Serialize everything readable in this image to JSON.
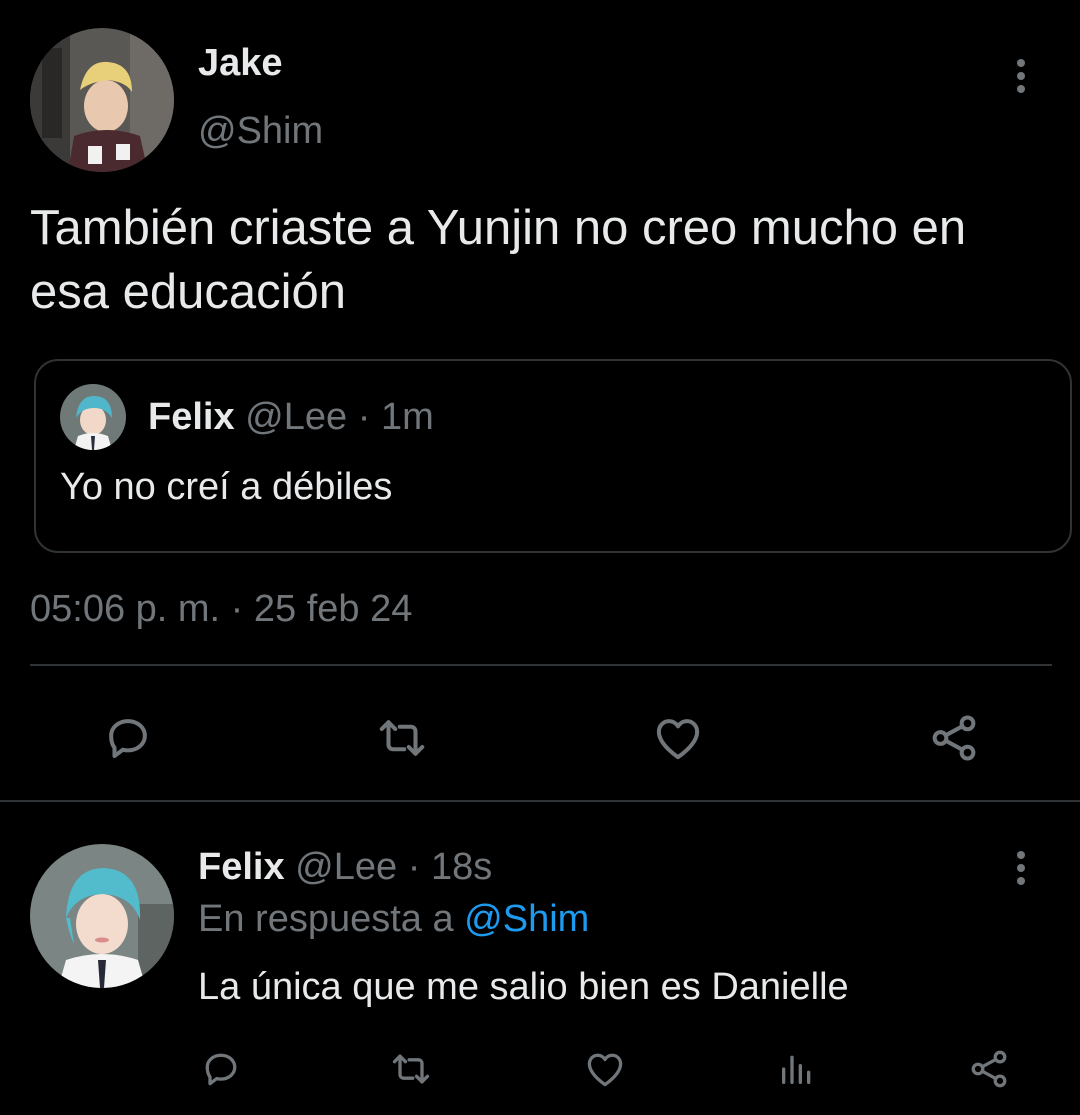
{
  "colors": {
    "background": "#000000",
    "text": "#e7e9ea",
    "muted": "#71767b",
    "accent": "#1d9bf0",
    "border": "#2f3336"
  },
  "main_tweet": {
    "name": "Jake",
    "handle": "@Shim",
    "text": "También criaste a Yunjin no creo mucho en esa educación",
    "timestamp": "05:06 p. m. · 25 feb 24",
    "quote": {
      "name": "Felix",
      "handle": "@Lee",
      "separator": "·",
      "time": "1m",
      "text": "Yo no creí a débiles"
    },
    "actions": [
      "reply-icon",
      "retweet-icon",
      "like-icon",
      "share-icon"
    ]
  },
  "reply": {
    "name": "Felix",
    "handle": "@Lee",
    "separator": "·",
    "time": "18s",
    "reply_prefix": "En respuesta a ",
    "reply_to": "@Shim",
    "text": "La única que me salio bien es Danielle",
    "actions": [
      "reply-icon",
      "retweet-icon",
      "like-icon",
      "analytics-icon",
      "share-icon"
    ]
  }
}
